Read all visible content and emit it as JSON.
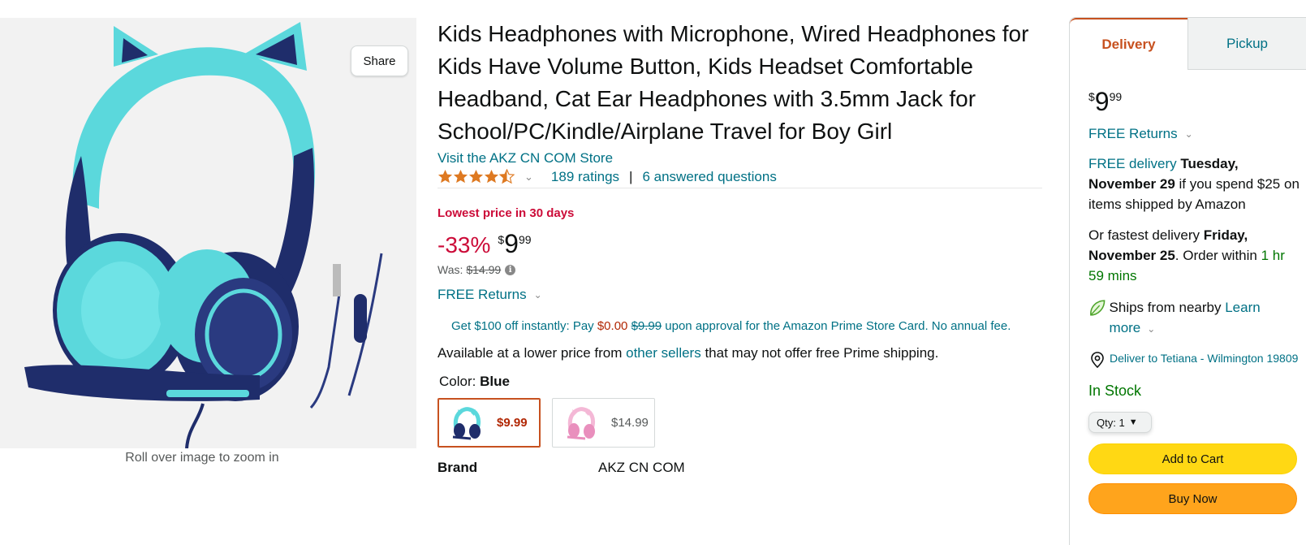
{
  "image": {
    "share_label": "Share",
    "zoom_hint": "Roll over image to zoom in"
  },
  "product": {
    "title": "Kids Headphones with Microphone, Wired Headphones for Kids Have Volume Button, Kids Headset Comfortable Headband, Cat Ear Headphones with 3.5mm Jack for School/PC/Kindle/Airplane Travel for Boy Girl",
    "store_link": "Visit the AKZ CN COM Store",
    "rating_stars": 4.5,
    "ratings_count": "189 ratings",
    "rating_separator": "|",
    "answered_questions": "6 answered questions",
    "deal_label": "Lowest price in 30 days",
    "discount": "-33%",
    "price_symbol": "$",
    "price_whole": "9",
    "price_fraction": "99",
    "was_label": "Was:",
    "was_price": "$14.99",
    "returns_label": "FREE Returns",
    "promo": {
      "text_before": "Get $100 off instantly: Pay ",
      "pay_amount": "$0.00",
      "struck_amount": "$9.99",
      "text_after": " upon approval for the Amazon Prime Store Card. No annual fee."
    },
    "availability": {
      "before": "Available at a lower price from ",
      "link": "other sellers",
      "after": " that may not offer free Prime shipping."
    },
    "color_label": "Color: ",
    "color_value": "Blue",
    "swatches": [
      {
        "price": "$9.99",
        "color": "blue",
        "selected": true
      },
      {
        "price": "$14.99",
        "color": "pink",
        "selected": false
      }
    ],
    "brand_key": "Brand",
    "brand_value": "AKZ CN COM"
  },
  "buybox": {
    "tab_delivery": "Delivery",
    "tab_pickup": "Pickup",
    "price_symbol": "$",
    "price_whole": "9",
    "price_fraction": "99",
    "returns_label": "FREE Returns",
    "delivery": {
      "link": "FREE delivery",
      "date": "Tuesday, November 29",
      "condition": " if you spend $25 on items shipped by Amazon"
    },
    "fast": {
      "prefix": "Or fastest delivery ",
      "date": "Friday, November 25",
      "order_within": ". Order within ",
      "countdown": "1 hr 59 mins"
    },
    "ships_text": "Ships from nearby ",
    "ships_link": "Learn more",
    "deliver_to": "Deliver to Tetiana - Wilmington 19809",
    "stock": "In Stock",
    "qty_label": "Qty:",
    "qty_value": "1",
    "add_to_cart": "Add to Cart",
    "buy_now": "Buy Now"
  },
  "colors": {
    "link": "#007185",
    "deal_red": "#cc0c39",
    "price_red": "#b12704",
    "in_stock_green": "#007600",
    "add_to_cart_yellow": "#ffd814",
    "buy_now_orange": "#ffa41c",
    "star_orange": "#de7921",
    "tab_active": "#c7511f"
  }
}
